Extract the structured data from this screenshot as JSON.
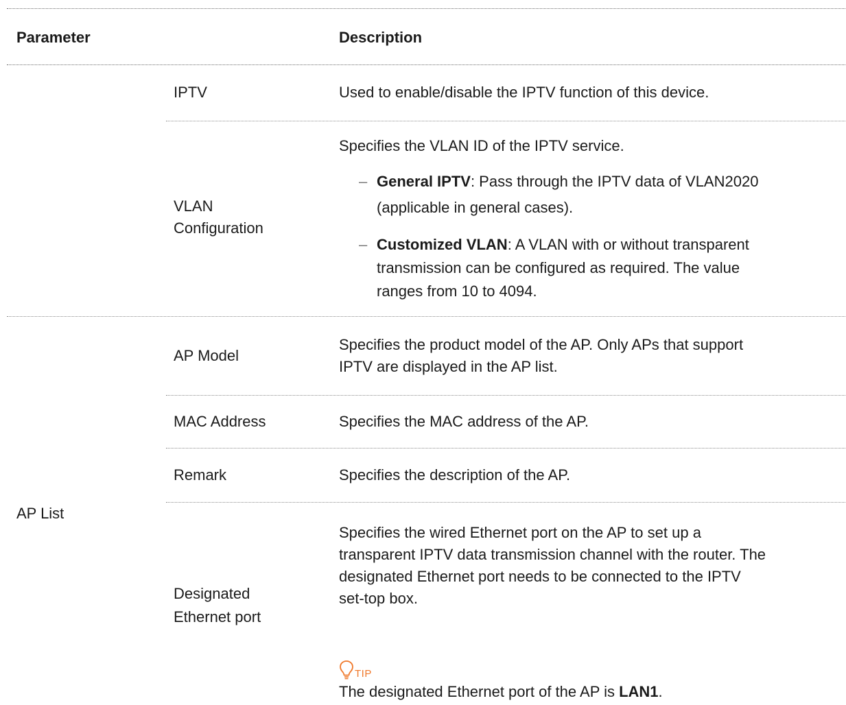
{
  "table": {
    "header": {
      "parameter": "Parameter",
      "description": "Description"
    },
    "groups": {
      "iptv_settings": {
        "rows": {
          "iptv": {
            "name": "IPTV",
            "description": "Used to enable/disable the IPTV function of this device."
          },
          "vlan": {
            "name_lines": [
              "VLAN",
              "Configuration"
            ],
            "intro": "Specifies the VLAN ID of the IPTV service.",
            "bullet_glyph": "–",
            "options": [
              {
                "term": "General IPTV",
                "lines": [
                  ": Pass through the IPTV data of VLAN2020",
                  "(applicable in general cases)."
                ]
              },
              {
                "term": "Customized VLAN",
                "lines": [
                  ": A VLAN with or without transparent",
                  "transmission can be configured as required. The value",
                  "ranges from 10 to 4094."
                ]
              }
            ]
          }
        }
      },
      "ap_list": {
        "label": "AP List",
        "rows": {
          "ap_model": {
            "name": "AP Model",
            "description_lines": [
              "Specifies the product model of the AP. Only APs that support",
              "IPTV are displayed in the AP list."
            ]
          },
          "mac_address": {
            "name": "MAC Address",
            "description": "Specifies the MAC address of the AP."
          },
          "remark": {
            "name": "Remark",
            "description": "Specifies the description of the AP."
          },
          "designated_port": {
            "name_lines": [
              "Designated",
              "Ethernet port"
            ],
            "description_lines": [
              "Specifies the wired Ethernet port on the AP to set up a",
              "transparent IPTV data transmission channel with the router. The",
              "designated Ethernet port needs to be connected to the IPTV",
              "set-top box."
            ],
            "tip": {
              "icon": "lightbulb-icon",
              "label": "TIP",
              "text_before": "The designated Ethernet port of the AP is ",
              "bold_value": "LAN1",
              "text_after": "."
            }
          }
        }
      }
    }
  },
  "colors": {
    "tip_accent": "#f0782a",
    "rule": "#8c8c8c",
    "text": "#1a1a1a"
  }
}
